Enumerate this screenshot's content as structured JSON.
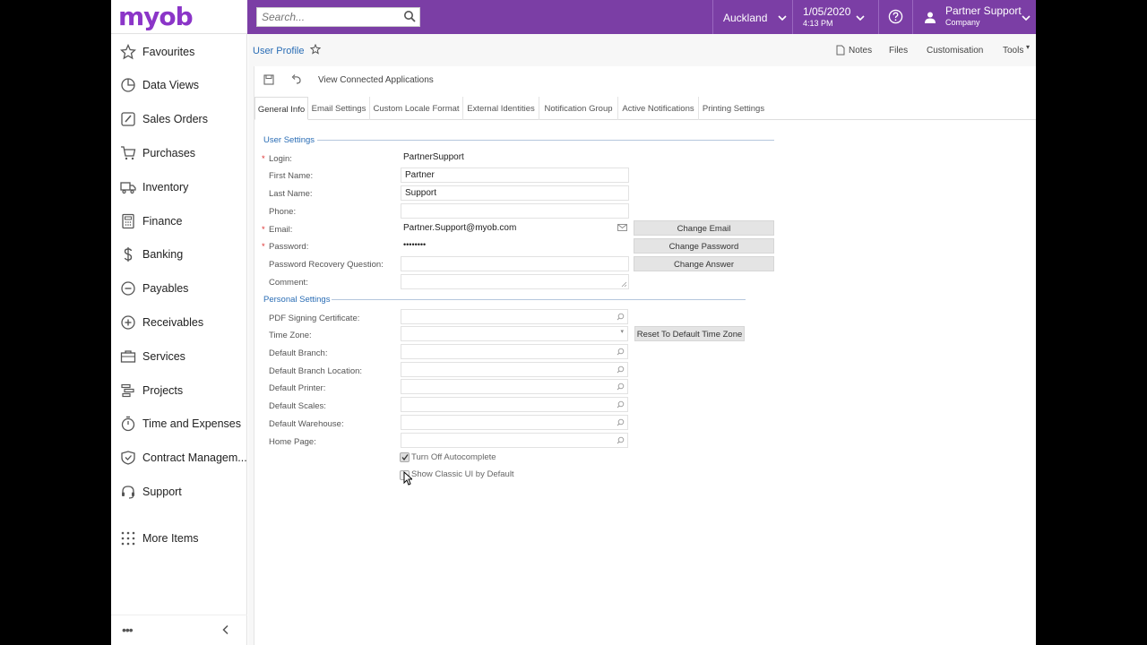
{
  "brand": {
    "logo": "myob",
    "accent": "#7b3ea5"
  },
  "search": {
    "placeholder": "Search..."
  },
  "topbar": {
    "branch": "Auckland",
    "date": "1/05/2020",
    "time": "4:13 PM",
    "user_name": "Partner Support",
    "user_company": "Company"
  },
  "sidebar": {
    "items": [
      {
        "label": "Favourites",
        "icon": "star-icon"
      },
      {
        "label": "Data Views",
        "icon": "pie-chart-icon"
      },
      {
        "label": "Sales Orders",
        "icon": "pencil-icon"
      },
      {
        "label": "Purchases",
        "icon": "cart-icon"
      },
      {
        "label": "Inventory",
        "icon": "truck-icon"
      },
      {
        "label": "Finance",
        "icon": "calculator-icon"
      },
      {
        "label": "Banking",
        "icon": "dollar-icon"
      },
      {
        "label": "Payables",
        "icon": "minus-circle-icon"
      },
      {
        "label": "Receivables",
        "icon": "plus-circle-icon"
      },
      {
        "label": "Services",
        "icon": "briefcase-icon"
      },
      {
        "label": "Projects",
        "icon": "gantt-icon"
      },
      {
        "label": "Time and Expenses",
        "icon": "stopwatch-icon"
      },
      {
        "label": "Contract Managem...",
        "icon": "shield-icon"
      },
      {
        "label": "Support",
        "icon": "headset-icon"
      },
      {
        "label": "More Items",
        "icon": "grid-icon"
      }
    ],
    "more_dots": "•••"
  },
  "page": {
    "title": "User Profile",
    "tools": {
      "notes": "Notes",
      "files": "Files",
      "customisation": "Customisation",
      "tools": "Tools"
    },
    "toolbar_text": "View Connected Applications"
  },
  "tabs": [
    "General Info",
    "Email Settings",
    "Custom Locale Format",
    "External Identities",
    "Notification Group",
    "Active Notifications",
    "Printing Settings"
  ],
  "user_settings": {
    "heading": "User Settings",
    "login_label": "Login:",
    "login_value": "PartnerSupport",
    "first_name_label": "First Name:",
    "first_name_value": "Partner",
    "last_name_label": "Last Name:",
    "last_name_value": "Support",
    "phone_label": "Phone:",
    "phone_value": "",
    "email_label": "Email:",
    "email_value": "Partner.Support@myob.com",
    "password_label": "Password:",
    "password_value": "••••••••",
    "recovery_label": "Password Recovery Question:",
    "recovery_value": "",
    "comment_label": "Comment:",
    "comment_value": "",
    "change_email": "Change Email",
    "change_password": "Change Password",
    "change_answer": "Change Answer"
  },
  "personal_settings": {
    "heading": "Personal Settings",
    "pdf_label": "PDF Signing Certificate:",
    "timezone_label": "Time Zone:",
    "branch_label": "Default Branch:",
    "branch_location_label": "Default Branch Location:",
    "printer_label": "Default Printer:",
    "scales_label": "Default Scales:",
    "warehouse_label": "Default Warehouse:",
    "home_page_label": "Home Page:",
    "reset_tz": "Reset To Default Time Zone",
    "autocomplete_label": "Turn Off Autocomplete",
    "autocomplete_checked": true,
    "classic_ui_label": "Show Classic UI by Default",
    "classic_ui_checked": false
  }
}
